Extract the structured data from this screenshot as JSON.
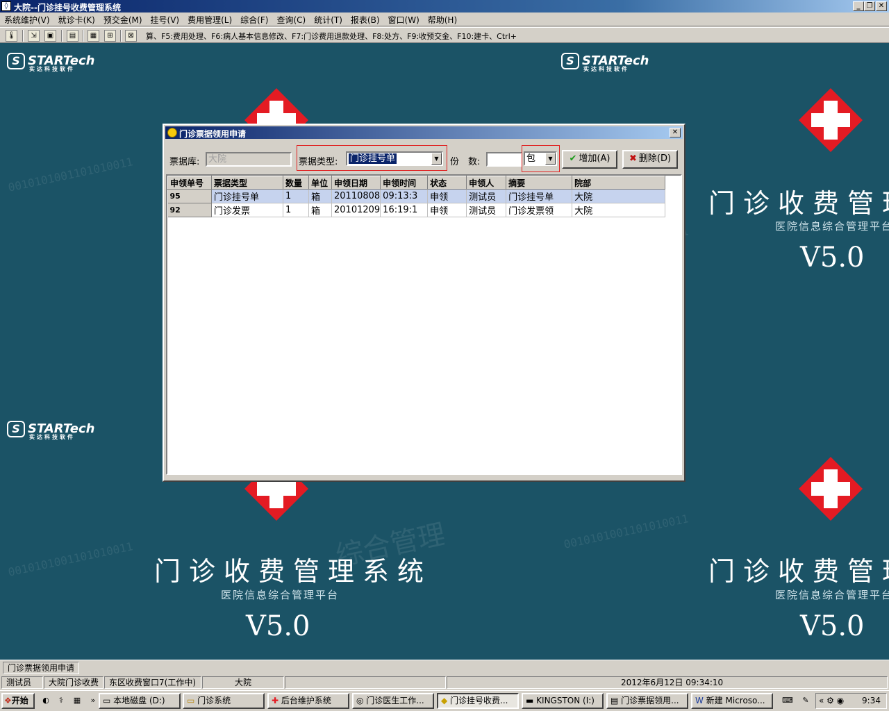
{
  "window": {
    "title": "大院--门诊挂号收费管理系统"
  },
  "menu": [
    "系统维护(V)",
    "就诊卡(K)",
    "预交金(M)",
    "挂号(V)",
    "费用管理(L)",
    "综合(F)",
    "查询(C)",
    "统计(T)",
    "报表(B)",
    "窗口(W)",
    "帮助(H)"
  ],
  "toolbar": {
    "hotkeys": "算、F5:费用处理、F6:病人基本信息修改、F7:门诊费用退款处理、F8:处方、F9:收预交金、F10:建卡、Ctrl+"
  },
  "background": {
    "logo_text": "STARTech",
    "logo_subtitle": "实达科技软件",
    "system_title": "门诊收费管理系统",
    "platform": "医院信息综合管理平台",
    "version": "V5.0",
    "watermark": "综合管理信息平台",
    "binary": "0010101001101010011"
  },
  "dialog": {
    "title": "门诊票据领用申请",
    "warehouse_label": "票据库:",
    "warehouse_value": "大院",
    "type_label": "票据类型:",
    "type_value": "门诊挂号单",
    "qty_label": "份　数:",
    "qty_value": "",
    "unit_value": "包",
    "add_button": "增加(A)",
    "delete_button": "删除(D)",
    "table": {
      "columns": [
        "申领单号",
        "票据类型",
        "数量",
        "单位",
        "申领日期",
        "申领时间",
        "状态",
        "申领人",
        "摘要",
        "院部"
      ],
      "rows": [
        [
          "95",
          "门诊挂号单",
          "1",
          "箱",
          "20110808",
          "09:13:3",
          "申领",
          "测试员",
          "门诊挂号单",
          "大院"
        ],
        [
          "92",
          "门诊发票",
          "1",
          "箱",
          "20101209",
          "16:19:1",
          "申领",
          "测试员",
          "门诊发票领",
          "大院"
        ]
      ]
    }
  },
  "tab_strip": {
    "active_tab": "门诊票据领用申请"
  },
  "status": {
    "user": "测试员",
    "module": "大院门诊收费",
    "window": "东区收费窗口7(工作中)",
    "campus": "大院",
    "datetime": "2012年6月12日 09:34:10"
  },
  "taskbar": {
    "start": "开始",
    "tasks": [
      "本地磁盘 (D:)",
      "门诊系统",
      "后台维护系统",
      "门诊医生工作...",
      "门诊挂号收费...",
      "KINGSTON (I:)",
      "门诊票据领用...",
      "新建 Microso..."
    ],
    "clock": "9:34"
  },
  "colors": {
    "desktop": "#1b5366",
    "titlebar": "#0a246a",
    "selected_row": "#c6d3ee",
    "highlight_box": "#e02020",
    "cross": "#e41b23"
  }
}
